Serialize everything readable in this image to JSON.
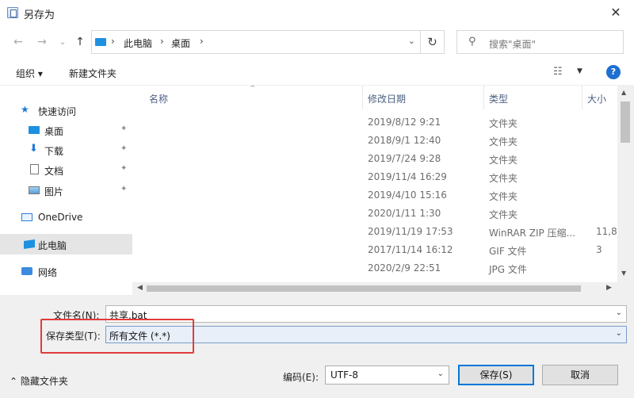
{
  "window": {
    "title": "另存为",
    "close_glyph": "✕"
  },
  "nav": {
    "back_glyph": "←",
    "forward_glyph": "→",
    "recent_glyph": "⌄",
    "up_glyph": "↑",
    "breadcrumb": [
      "此电脑",
      "桌面"
    ],
    "separator": "›",
    "dropdown_glyph": "⌄",
    "refresh_glyph": "↻",
    "search_placeholder": "搜索\"桌面\"",
    "search_glyph": "⚲"
  },
  "toolbar": {
    "organize_label": "组织 ▾",
    "new_folder_label": "新建文件夹",
    "view_glyph": "☷",
    "view_dropdown_glyph": "▼",
    "help_glyph": "?"
  },
  "sidebar": {
    "pin_glyph": "📌",
    "items": [
      {
        "label": "快速访问",
        "icon": "star-icon"
      },
      {
        "label": "桌面",
        "icon": "desktop-icon"
      },
      {
        "label": "下载",
        "icon": "download-icon"
      },
      {
        "label": "文档",
        "icon": "document-icon"
      },
      {
        "label": "图片",
        "icon": "pictures-icon"
      },
      {
        "label": "OneDrive",
        "icon": "onedrive-icon"
      },
      {
        "label": "此电脑",
        "icon": "computer-icon",
        "selected": true
      },
      {
        "label": "网络",
        "icon": "network-icon"
      }
    ]
  },
  "files": {
    "columns": [
      "名称",
      "修改日期",
      "类型",
      "大小"
    ],
    "sort_glyph": "^",
    "rows": [
      {
        "date": "2019/8/12 9:21",
        "type": "文件夹",
        "size": ""
      },
      {
        "date": "2018/9/1 12:40",
        "type": "文件夹",
        "size": ""
      },
      {
        "date": "2019/7/24 9:28",
        "type": "文件夹",
        "size": ""
      },
      {
        "date": "2019/11/4 16:29",
        "type": "文件夹",
        "size": ""
      },
      {
        "date": "2019/4/10 15:16",
        "type": "文件夹",
        "size": ""
      },
      {
        "date": "2020/1/11 1:30",
        "type": "文件夹",
        "size": ""
      },
      {
        "date": "2019/11/19 17:53",
        "type": "WinRAR ZIP 压缩...",
        "size": "11,8"
      },
      {
        "date": "2017/11/14 16:12",
        "type": "GIF 文件",
        "size": "3"
      },
      {
        "date": "2020/2/9 22:51",
        "type": "JPG 文件",
        "size": ""
      }
    ],
    "scroll": {
      "up": "▲",
      "down": "▼",
      "left": "◀",
      "right": "▶"
    }
  },
  "form": {
    "filename_label": "文件名(N):",
    "filename_value": "共享.bat",
    "type_label": "保存类型(T):",
    "type_value": "所有文件 (*.*)",
    "dropdown_glyph": "⌄",
    "hide_folders_label": "⌃  隐藏文件夹",
    "encoding_label": "编码(E):",
    "encoding_value": "UTF-8",
    "save_label": "保存(S)",
    "cancel_label": "取消"
  },
  "colors": {
    "accent": "#0078d7",
    "highlight_box": "#e23b3b"
  }
}
